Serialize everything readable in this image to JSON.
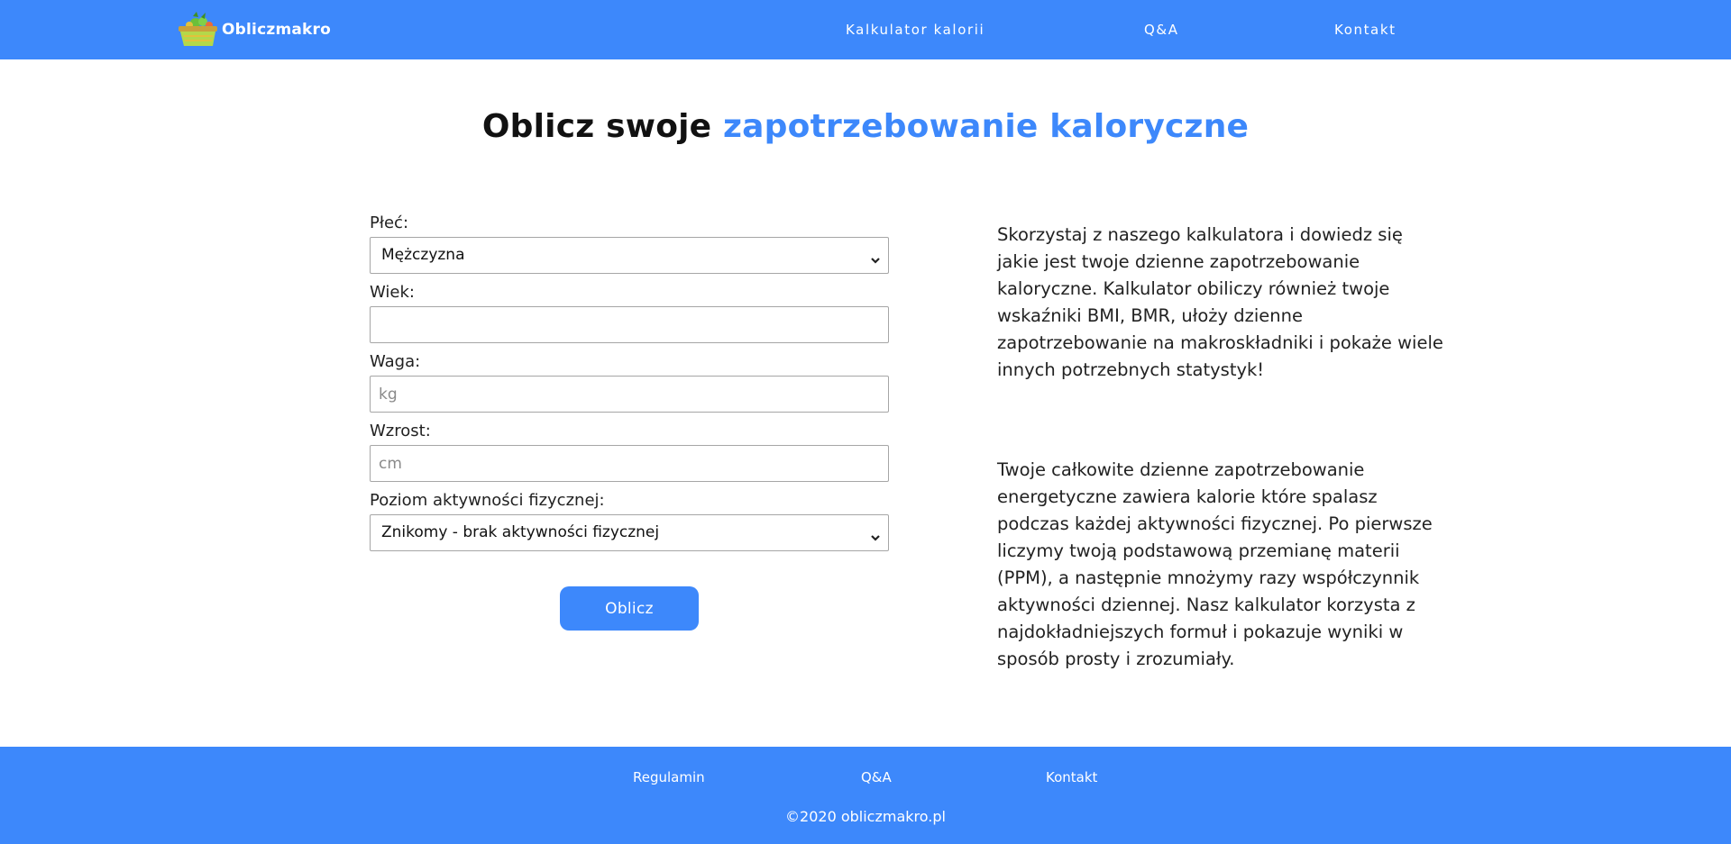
{
  "header": {
    "brand": "Obliczmakro",
    "logo_icon": "vegetable-basket-icon",
    "nav": [
      {
        "label": "Kalkulator kalorii"
      },
      {
        "label": "Q&A"
      },
      {
        "label": "Kontakt"
      }
    ]
  },
  "main": {
    "title_prefix": "Oblicz swoje ",
    "title_accent": "zapotrzebowanie kaloryczne",
    "form": {
      "gender_label": "Płeć:",
      "gender_value": "Mężczyzna",
      "age_label": "Wiek:",
      "age_value": "",
      "weight_label": "Waga:",
      "weight_placeholder": "kg",
      "height_label": "Wzrost:",
      "height_placeholder": "cm",
      "activity_label": "Poziom aktywności fizycznej:",
      "activity_value": "Znikomy - brak aktywności fizycznej",
      "submit_label": "Oblicz"
    },
    "description_1": "Skorzystaj z naszego kalkulatora i dowiedz się jakie jest twoje dzienne zapotrzebowanie kaloryczne. Kalkulator obiliczy również twoje wskaźniki BMI, BMR, ułoży dzienne zapotrzebowanie na makroskładniki i pokaże wiele innych potrzebnych statystyk!",
    "description_2": "Twoje całkowite dzienne zapotrzebowanie energetyczne zawiera kalorie które spalasz podczas każdej aktywności fizycznej. Po pierwsze liczymy twoją podstawową przemianę materii (PPM), a następnie mnożymy razy współczynnik aktywności dziennej. Nasz kalkulator korzysta z najdokładniejszych formuł i pokazuje wyniki w sposób prosty i zrozumiały."
  },
  "footer": {
    "links": [
      {
        "label": "Regulamin"
      },
      {
        "label": "Q&A"
      },
      {
        "label": "Kontakt"
      }
    ],
    "copyright": "©2020 obliczmakro.pl"
  },
  "colors": {
    "brand_blue": "#3d88fb",
    "text": "#222222",
    "white": "#ffffff"
  }
}
